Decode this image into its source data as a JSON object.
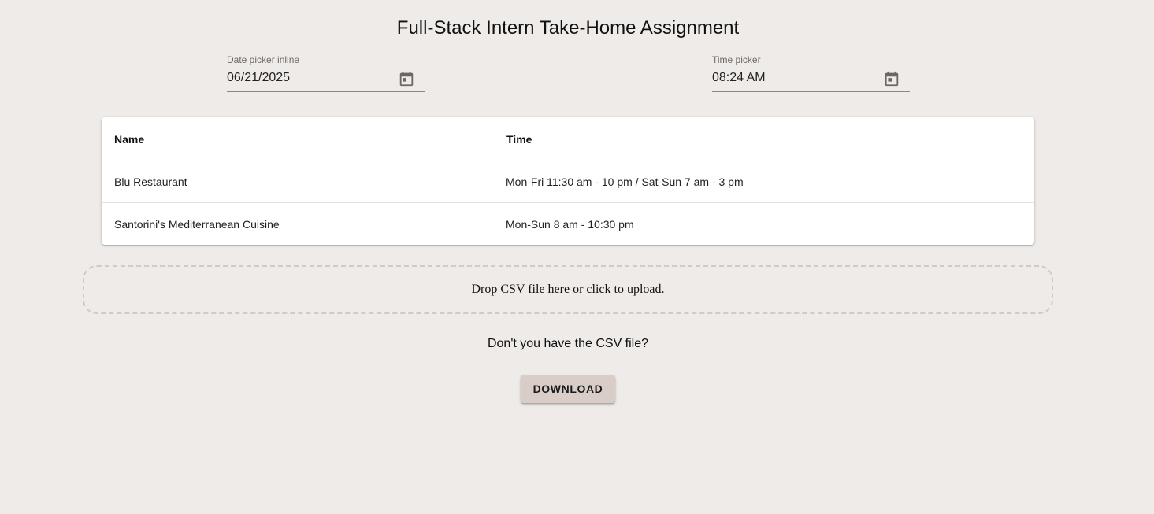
{
  "page": {
    "title": "Full-Stack Intern Take-Home Assignment"
  },
  "date_picker": {
    "label": "Date picker inline",
    "value": "06/21/2025",
    "icon": "calendar-icon"
  },
  "time_picker": {
    "label": "Time picker",
    "value": "08:24 AM",
    "icon": "calendar-icon"
  },
  "table": {
    "columns": [
      "Name",
      "Time"
    ],
    "rows": [
      [
        "Blu Restaurant",
        "Mon-Fri 11:30 am - 10 pm / Sat-Sun 7 am - 3 pm"
      ],
      [
        "Santorini's Mediterranean Cuisine",
        "Mon-Sun 8 am - 10:30 pm"
      ]
    ]
  },
  "upload": {
    "dropzone_text": "Drop CSV file here or click to upload."
  },
  "download": {
    "question": "Don't you have the CSV file?",
    "button_label": "DOWNLOAD"
  },
  "colors": {
    "background": "#eeebe8",
    "button": "#d9cdc8",
    "icon": "#6a6764"
  }
}
